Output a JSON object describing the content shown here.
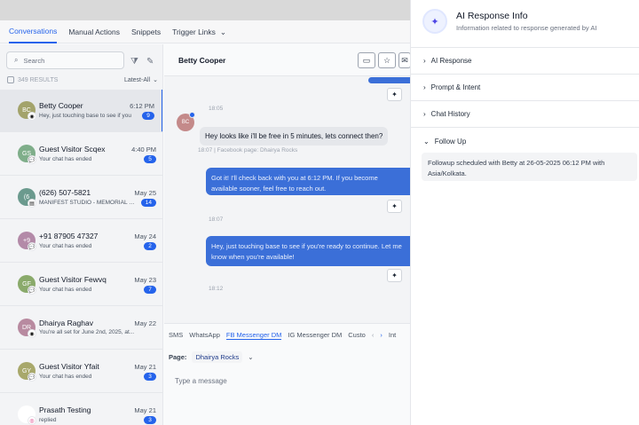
{
  "tabs": [
    {
      "label": "Conversations",
      "active": true
    },
    {
      "label": "Manual Actions"
    },
    {
      "label": "Snippets"
    },
    {
      "label": "Trigger Links"
    }
  ],
  "search": {
    "placeholder": "Search"
  },
  "results": {
    "count": "349 RESULTS",
    "sort": "Latest-All"
  },
  "conversations": [
    {
      "initials": "BC",
      "color": "#a3a36b",
      "name": "Betty Cooper",
      "time": "6:12 PM",
      "preview": "Hey, just touching base to see if you",
      "badge": "9",
      "channel": "messenger"
    },
    {
      "initials": "GS",
      "color": "#7fae8a",
      "name": "Guest Visitor Scqex",
      "time": "4:40 PM",
      "preview": "Your chat has ended",
      "badge": "5",
      "channel": "chat"
    },
    {
      "initials": "(6",
      "color": "#6b9a8e",
      "name": "(626) 507-5821",
      "time": "May 25",
      "preview": "MANIFEST STUDIO - MEMORIAL DAY",
      "badge": "14",
      "channel": "sms"
    },
    {
      "initials": "+9",
      "color": "#b38aa8",
      "name": "+91 87905 47327",
      "time": "May 24",
      "preview": "Your chat has ended",
      "badge": "2",
      "channel": "chat"
    },
    {
      "initials": "GF",
      "color": "#8aaa6b",
      "name": "Guest Visitor Fewvq",
      "time": "May 23",
      "preview": "Your chat has ended",
      "badge": "7",
      "channel": "chat"
    },
    {
      "initials": "DR",
      "color": "#b88aa0",
      "name": "Dhairya Raghav",
      "time": "May 22",
      "preview": "You're all set for June 2nd, 2025, at...",
      "badge": "",
      "channel": "messenger"
    },
    {
      "initials": "GY",
      "color": "#a8a86b",
      "name": "Guest Visitor Yfait",
      "time": "May 21",
      "preview": "Your chat has ended",
      "badge": "3",
      "channel": "chat"
    },
    {
      "initials": "",
      "color": "#ffffff",
      "name": "Prasath Testing",
      "time": "May 21",
      "preview": "replied",
      "badge": "3",
      "channel": "instagram"
    }
  ],
  "chat": {
    "contact": "Betty Cooper",
    "messages": {
      "time1": "18:05",
      "in_text": "Hey looks like i'll be free in 5 minutes, lets connect then?",
      "in_meta": "18:07 | Facebook page: Dhairya Rocks",
      "in_initials": "BC",
      "out2_text": "Got it! I'll check back with you at 6:12 PM. If you become available sooner, feel free to reach out.",
      "time2": "18:07",
      "out3_text": "Hey, just touching base to see if you're ready to continue. Let me know when you're available!",
      "time3": "18:12"
    },
    "compose_tabs": [
      "SMS",
      "WhatsApp",
      "FB Messenger DM",
      "IG Messenger DM",
      "Custo",
      "Int"
    ],
    "active_compose_tab": "FB Messenger DM",
    "page_label": "Page:",
    "page_value": "Dhairya Rocks",
    "placeholder": "Type a message"
  },
  "panel": {
    "title": "AI Response Info",
    "subtitle": "Information related to response generated by AI",
    "sections": [
      "AI Response",
      "Prompt & Intent",
      "Chat History",
      "Follow Up"
    ],
    "followup_text": "Followup scheduled with Betty at 26-05-2025 06:12 PM with Asia/Kolkata."
  },
  "colors": {
    "accent": "#2563eb",
    "bubble_out": "#3b6fd8"
  }
}
